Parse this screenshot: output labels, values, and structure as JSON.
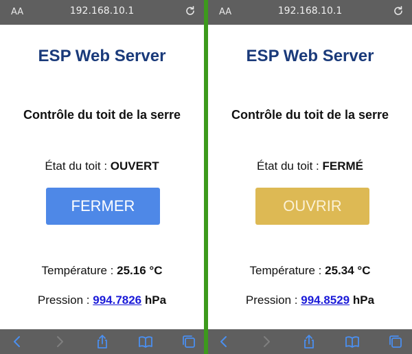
{
  "left": {
    "url": "192.168.10.1",
    "aa_label": "AA",
    "title": "ESP Web Server",
    "subtitle": "Contrôle du toit de la serre",
    "state_label": "État du toit : ",
    "state_value": "OUVERT",
    "button_label": "FERMER",
    "temperature_label": "Température : ",
    "temperature_value": "25.16 °C",
    "pressure_label": "Pression : ",
    "pressure_value": "994.7826",
    "pressure_unit": "hPa"
  },
  "right": {
    "url": "192.168.10.1",
    "aa_label": "AA",
    "title": "ESP Web Server",
    "subtitle": "Contrôle du toit de la serre",
    "state_label": "État du toit : ",
    "state_value": "FERMÉ",
    "button_label": "OUVRIR",
    "temperature_label": "Température : ",
    "temperature_value": "25.34 °C",
    "pressure_label": "Pression : ",
    "pressure_value": "994.8529",
    "pressure_unit": "hPa"
  },
  "colors": {
    "divider": "#3d9a1c",
    "title": "#1a3a7a",
    "button_fermer": "#4e88e7",
    "button_ouvrir": "#ddb954",
    "link": "#1a1ad8",
    "browser_bar": "#5f5f5f"
  },
  "icons": {
    "reload": "reload-icon",
    "back": "back-chevron-icon",
    "forward": "forward-chevron-icon",
    "share": "share-icon",
    "bookmarks": "bookmarks-icon",
    "tabs": "tabs-icon"
  }
}
